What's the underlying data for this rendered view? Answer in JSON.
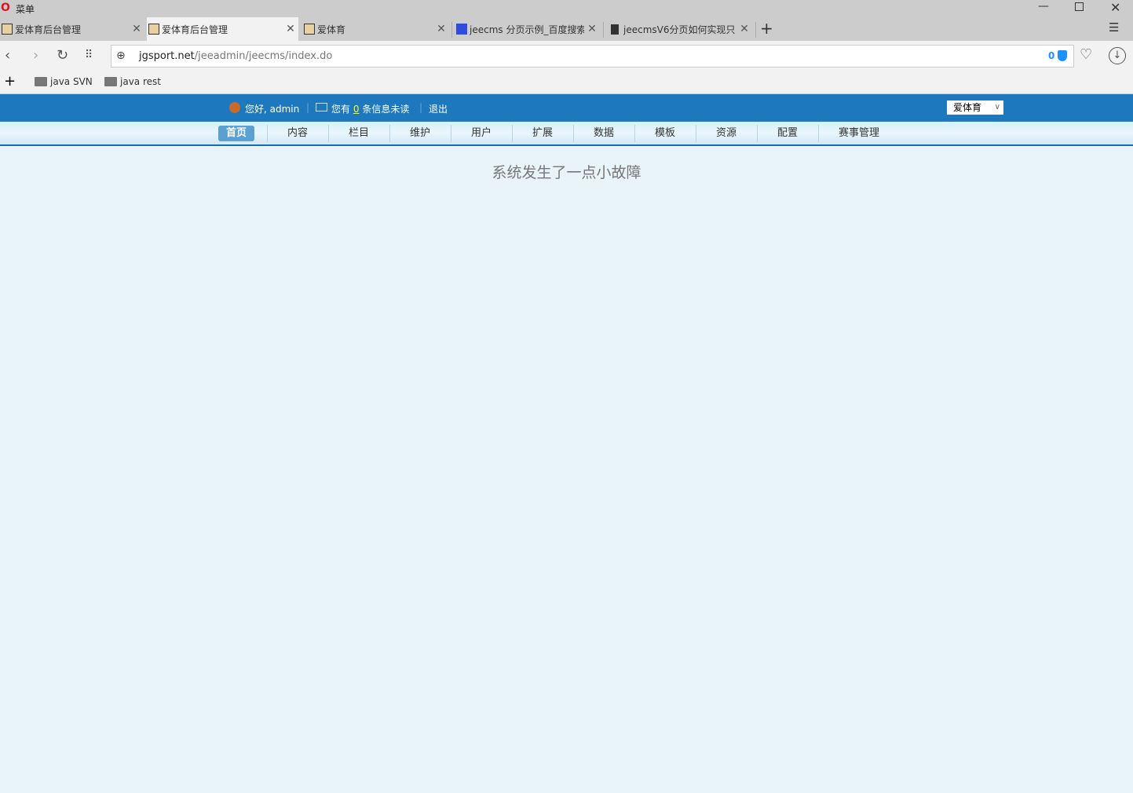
{
  "browser": {
    "menu_label": "菜单",
    "tabs": [
      {
        "title": "爱体育后台管理",
        "icon": "tomcat-icon"
      },
      {
        "title": "爱体育后台管理",
        "icon": "tomcat-icon",
        "active": true
      },
      {
        "title": "爱体育",
        "icon": "tomcat-icon"
      },
      {
        "title": "jeecms 分页示例_百度搜索",
        "icon": "baidu-icon"
      },
      {
        "title": "jeecmsV6分页如何实现只",
        "icon": "document-icon"
      }
    ],
    "new_tab": "+",
    "url_host": "jgsport.net",
    "url_path": "/jeeadmin/jeecms/index.do",
    "adblock_count": "0",
    "bookmarks": [
      "java SVN",
      "java rest"
    ]
  },
  "header": {
    "greeting": "您好, admin",
    "msg_prefix": "您有",
    "msg_count": "0",
    "msg_suffix": "条信息未读",
    "logout": "退出",
    "site_select": "爱体育",
    "accent": "#1e78be"
  },
  "nav": [
    "首页",
    "内容",
    "栏目",
    "维护",
    "用户",
    "扩展",
    "数据",
    "模板",
    "资源",
    "配置",
    "赛事管理"
  ],
  "main": {
    "error": "系统发生了一点小故障"
  }
}
